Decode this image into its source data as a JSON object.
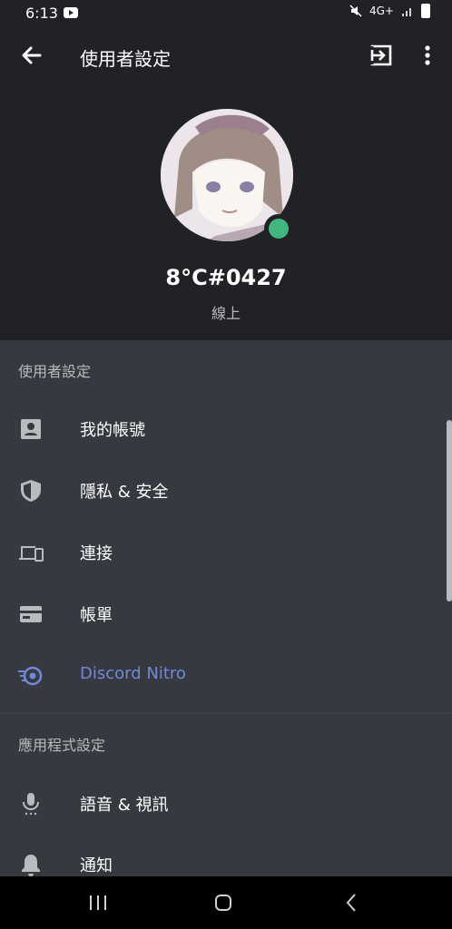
{
  "status_bar": {
    "time": "6:13",
    "network": "4G+"
  },
  "header": {
    "title": "使用者設定",
    "username": "8°C#0427",
    "status": "線上"
  },
  "sections": {
    "user_settings_label": "使用者設定",
    "app_settings_label": "應用程式設定"
  },
  "items": {
    "my_account": "我的帳號",
    "privacy": "隱私 & 安全",
    "connections": "連接",
    "billing": "帳單",
    "nitro": "Discord Nitro",
    "voice": "語音 & 視訊",
    "notifications": "通知"
  },
  "colors": {
    "background": "#36393f",
    "header": "#202225",
    "online": "#43b581",
    "nitro": "#7289da"
  }
}
